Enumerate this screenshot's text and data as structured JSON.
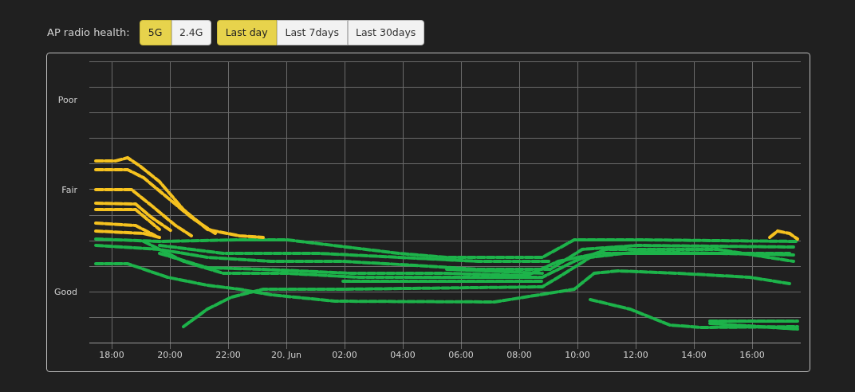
{
  "header": {
    "label": "AP radio health:"
  },
  "band_buttons": [
    {
      "label": "5G",
      "selected": true
    },
    {
      "label": "2.4G",
      "selected": false
    }
  ],
  "range_buttons": [
    {
      "label": "Last day",
      "selected": true
    },
    {
      "label": "Last 7days",
      "selected": false
    },
    {
      "label": "Last 30days",
      "selected": false
    }
  ],
  "chart": {
    "y_labels": [
      "Poor",
      "Fair",
      "Good"
    ],
    "x_labels": [
      "18:00",
      "20:00",
      "22:00",
      "20. Jun",
      "02:00",
      "04:00",
      "06:00",
      "08:00",
      "10:00",
      "12:00",
      "14:00",
      "16:00"
    ]
  }
}
